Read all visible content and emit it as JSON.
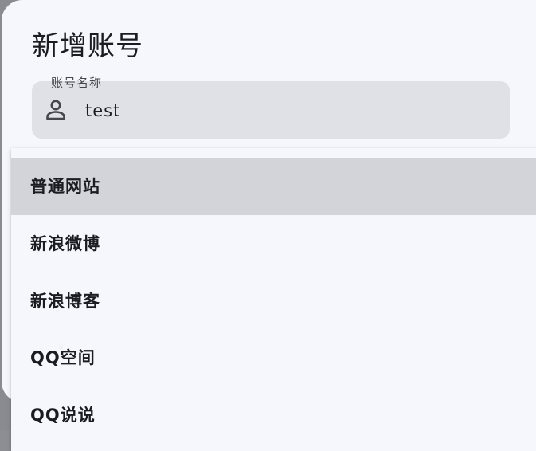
{
  "dialog": {
    "title": "新增账号",
    "account_name_field": {
      "label": "账号名称",
      "value": "test",
      "icon": "person-icon"
    }
  },
  "dropdown": {
    "selected": "普通网站",
    "options": [
      "普通网站",
      "新浪微博",
      "新浪博客",
      "QQ空间",
      "QQ说说"
    ]
  },
  "colors": {
    "surface": "#f6f7fc",
    "field_fill": "#e0e1e6",
    "selected_option": "#d3d4d9",
    "scrim": "#8a8b90"
  }
}
